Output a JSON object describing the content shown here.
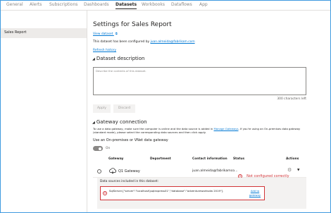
{
  "tabs": [
    "General",
    "Alerts",
    "Subscriptions",
    "Dashboards",
    "Datasets",
    "Workbooks",
    "Dataflows",
    "App"
  ],
  "active_tab": "Datasets",
  "sidebar": {
    "items": [
      {
        "label": "Sales Report"
      }
    ]
  },
  "settings": {
    "title": "Settings for Sales Report",
    "view_dataset": "View dataset",
    "configured_by_prefix": "This dataset has been configured by",
    "configured_by_email": "juan.almeida@fabrikam.com",
    "refresh_history": "Refresh history"
  },
  "description": {
    "heading": "Dataset description",
    "placeholder": "Describe the contents of this dataset.",
    "char_count": "300 characters left",
    "apply": "Apply",
    "discard": "Discard"
  },
  "gateway": {
    "heading": "Gateway connection",
    "info_prefix": "To use a data gateway, make sure the computer is online and the data source is added in",
    "manage_link": "Manage Gateways",
    "info_suffix": ". If you're using an On-premises data gateway (standard mode), please select the corresponding data sources and then click apply.",
    "use_label": "Use an On-premises or VNet data gateway",
    "toggle_label": "On",
    "columns": [
      "Gateway",
      "Department",
      "Contact information",
      "Status",
      "Actions"
    ],
    "row": {
      "name": "Q1 Gateway",
      "contact": "juan.almeida@fabrikamco...",
      "status": "Not configured correctly"
    },
    "datasources_label": "Data sources included in this dataset:",
    "datasource_text": "SqlServer{\"server\":\"localhost\\\\sqlexpress01\",\"database\":\"adventureworksdw 2019\"}",
    "add_link": "Add to gateway"
  },
  "colors": {
    "accent": "#0078d4",
    "error": "#d13438",
    "frame": "#3f9ae0"
  }
}
